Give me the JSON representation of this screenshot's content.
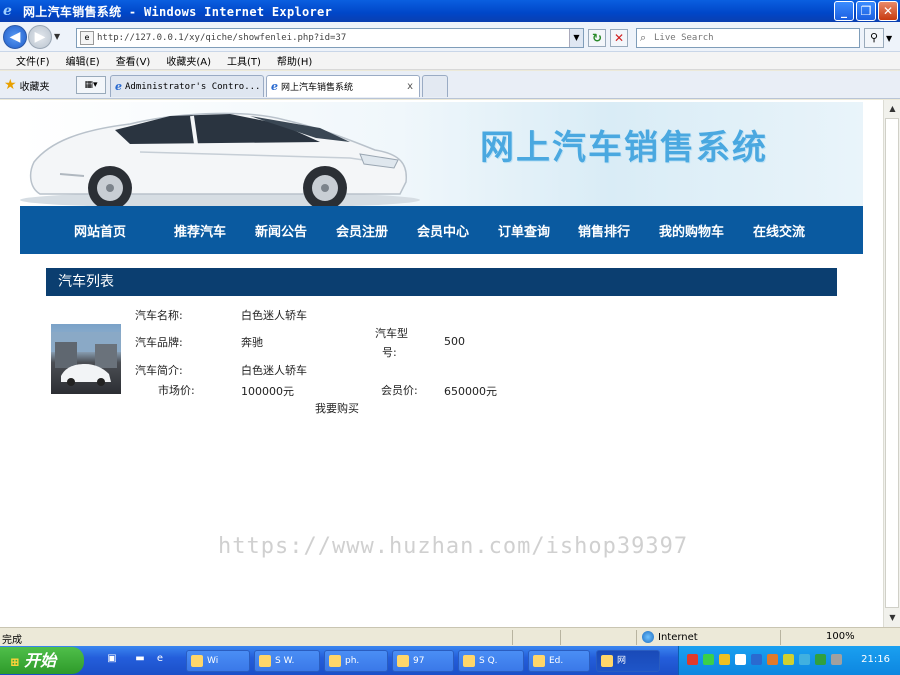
{
  "window": {
    "title": "网上汽车销售系统 - Windows Internet Explorer",
    "minimize": "_",
    "restore": "❐",
    "close": "✕"
  },
  "addressbar": {
    "url": "http://127.0.0.1/xy/qiche/showfenlei.php?id=37",
    "search_placeholder": "Live Search"
  },
  "menubar": {
    "items": [
      "文件(F)",
      "编辑(E)",
      "查看(V)",
      "收藏夹(A)",
      "工具(T)",
      "帮助(H)"
    ]
  },
  "favorites": {
    "label": "收藏夹"
  },
  "tabs": [
    {
      "label": "Administrator's Contro..."
    },
    {
      "label": "网上汽车销售系统",
      "close": "x"
    }
  ],
  "site": {
    "title": "网上汽车销售系统",
    "nav": [
      "网站首页",
      "推荐汽车",
      "新闻公告",
      "会员注册",
      "会员中心",
      "订单查询",
      "销售排行",
      "我的购物车",
      "在线交流"
    ]
  },
  "section": {
    "title": "汽车列表"
  },
  "car": {
    "name_label": "汽车名称:",
    "name": "白色迷人轿车",
    "brand_label": "汽车品牌:",
    "brand": "奔驰",
    "model_label_1": "汽车型",
    "model_label_2": "号:",
    "model": "500",
    "intro_label": "汽车简介:",
    "intro": "白色迷人轿车",
    "market_price_label": "市场价:",
    "market_price": "100000元",
    "member_price_label": "会员价:",
    "member_price": "650000元",
    "buy_label": "我要购买"
  },
  "watermark": "https://www.huzhan.com/ishop39397",
  "statusbar": {
    "status": "完成",
    "zone": "Internet",
    "zoom": "100%"
  },
  "taskbar": {
    "start": "开始",
    "items": [
      "Wi",
      "S W.",
      "ph.",
      "97",
      "S Q.",
      "Ed.",
      "网"
    ],
    "clock": "21:16"
  },
  "colors": {
    "nav_bg": "#0a5aa0",
    "section_bg": "#0b3e70",
    "title_blue": "#4aa8e0"
  }
}
